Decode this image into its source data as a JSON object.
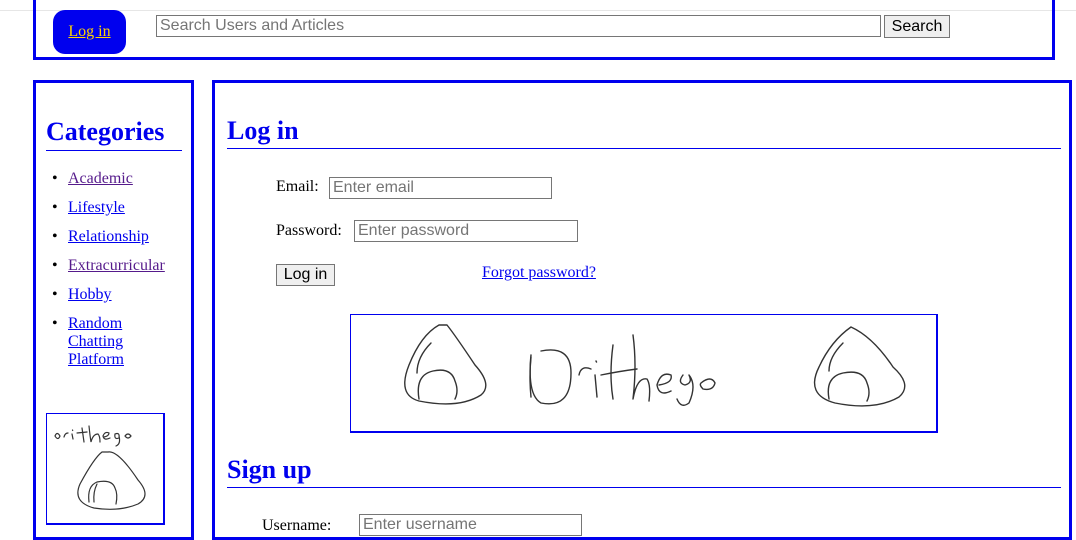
{
  "header": {
    "login_label": "Log in",
    "search_placeholder": "Search Users and Articles",
    "search_button": "Search"
  },
  "sidebar": {
    "title": "Categories",
    "items": [
      {
        "label": "Academic",
        "visited": true
      },
      {
        "label": "Lifestyle",
        "visited": false
      },
      {
        "label": "Relationship",
        "visited": false
      },
      {
        "label": "Extracurricular",
        "visited": true
      },
      {
        "label": "Hobby",
        "visited": false
      },
      {
        "label": "Random Chatting Platform",
        "visited": false
      }
    ],
    "signature_text": "ori thego"
  },
  "login": {
    "title": "Log in",
    "email_label": "Email:",
    "email_placeholder": "Enter email",
    "password_label": "Password:",
    "password_placeholder": "Enter password",
    "submit_label": "Log in",
    "forgot_label": "Forgot password?",
    "signature_text": "Orithego"
  },
  "signup": {
    "title": "Sign up",
    "username_label": "Username:",
    "username_placeholder": "Enter username"
  },
  "colors": {
    "accent": "#0000ee",
    "login_pill_text": "#ffd400",
    "visited_link": "#551a8b"
  }
}
